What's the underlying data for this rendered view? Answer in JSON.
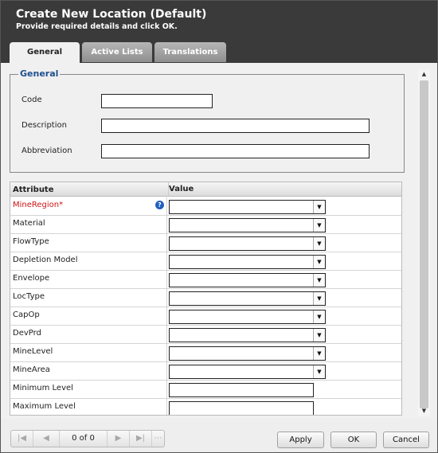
{
  "dialog": {
    "title": "Create New Location (Default)",
    "subtitle": "Provide required details and click OK."
  },
  "tabs": [
    {
      "label": "General",
      "active": true
    },
    {
      "label": "Active Lists",
      "active": false
    },
    {
      "label": "Translations",
      "active": false
    }
  ],
  "general": {
    "legend": "General",
    "fields": [
      {
        "label": "Code",
        "value": ""
      },
      {
        "label": "Description",
        "value": ""
      },
      {
        "label": "Abbreviation",
        "value": ""
      }
    ]
  },
  "attributes": {
    "columns": [
      "Attribute",
      "Value"
    ],
    "rows": [
      {
        "name": "MineRegion*",
        "required": true,
        "help": "?",
        "type": "select",
        "value": ""
      },
      {
        "name": "Material",
        "type": "select",
        "value": ""
      },
      {
        "name": "FlowType",
        "type": "select",
        "value": ""
      },
      {
        "name": "Depletion Model",
        "type": "select",
        "value": ""
      },
      {
        "name": "Envelope",
        "type": "select",
        "value": ""
      },
      {
        "name": "LocType",
        "type": "select",
        "value": ""
      },
      {
        "name": "CapOp",
        "type": "select",
        "value": ""
      },
      {
        "name": "DevPrd",
        "type": "select",
        "value": ""
      },
      {
        "name": "MineLevel",
        "type": "select",
        "value": ""
      },
      {
        "name": "MineArea",
        "type": "select",
        "value": ""
      },
      {
        "name": "Minimum Level",
        "type": "text",
        "value": ""
      },
      {
        "name": "Maximum Level",
        "type": "text",
        "value": ""
      }
    ]
  },
  "pager": {
    "text": "0 of 0",
    "first_icon": "first-page-icon",
    "prev_icon": "prev-page-icon",
    "next_icon": "next-page-icon",
    "last_icon": "last-page-icon"
  },
  "buttons": {
    "apply": "Apply",
    "ok": "OK",
    "cancel": "Cancel"
  },
  "colors": {
    "header_bg": "#3a3a3a",
    "legend": "#1f4f8f",
    "required": "#d01515",
    "help_icon": "#1f5fbf"
  }
}
